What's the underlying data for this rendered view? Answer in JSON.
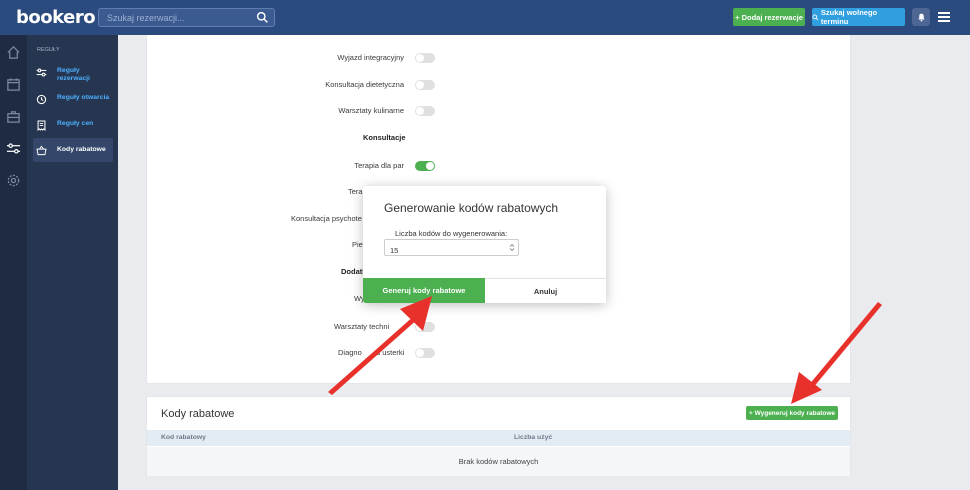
{
  "app": {
    "logo": "bookero"
  },
  "header": {
    "search_placeholder": "Szukaj rezerwacji...",
    "add_booking_label": "+ Dodaj rezerwacje",
    "find_slot_label": "Szukaj wolnego terminu"
  },
  "submenu": {
    "heading": "REGUŁY",
    "items": [
      {
        "label": "Reguły rezerwacji",
        "icon": "sliders-icon"
      },
      {
        "label": "Reguły otwarcia",
        "icon": "clock-icon"
      },
      {
        "label": "Reguły cen",
        "icon": "receipt-icon"
      },
      {
        "label": "Kody rabatowe",
        "icon": "basket-icon"
      }
    ]
  },
  "services": {
    "rows": [
      {
        "label": "Wyjazd integracyjny",
        "on": false
      },
      {
        "label": "Konsultacja dietetyczna",
        "on": false
      },
      {
        "label": "Warsztaty kulinarne",
        "on": false
      }
    ],
    "section_consult": "Konsultacje",
    "consult_rows": [
      {
        "label": "Terapia dla par",
        "on": true
      },
      {
        "label": "Terap",
        "on": false
      },
      {
        "label": "Konsultacja psychote",
        "on": false
      },
      {
        "label": "Pier",
        "on": false
      }
    ],
    "section_extra": "Dodatk",
    "extra_rows": [
      {
        "label": "Wy",
        "on": false
      },
      {
        "label": "Warsztaty techni",
        "on": false
      },
      {
        "label": "Diagno",
        "label2": "a usterki",
        "on": false
      }
    ]
  },
  "codes_panel": {
    "title": "Kody rabatowe",
    "generate_button": "+ Wygeneruj kody rabatowe",
    "col_code": "Kod rabatowy",
    "col_uses": "Liczba użyć",
    "empty": "Brak kodów rabatowych"
  },
  "modal": {
    "title": "Generowanie kodów rabatowych",
    "count_label": "Liczba kodów do wygenerowania:",
    "count_value": "15",
    "generate_button": "Generuj kody rabatowe",
    "cancel_button": "Anuluj"
  },
  "colors": {
    "topbar": "#2b4a7e",
    "green": "#4caf50",
    "blue": "#2f9fe0",
    "arrow": "#e8312a"
  }
}
